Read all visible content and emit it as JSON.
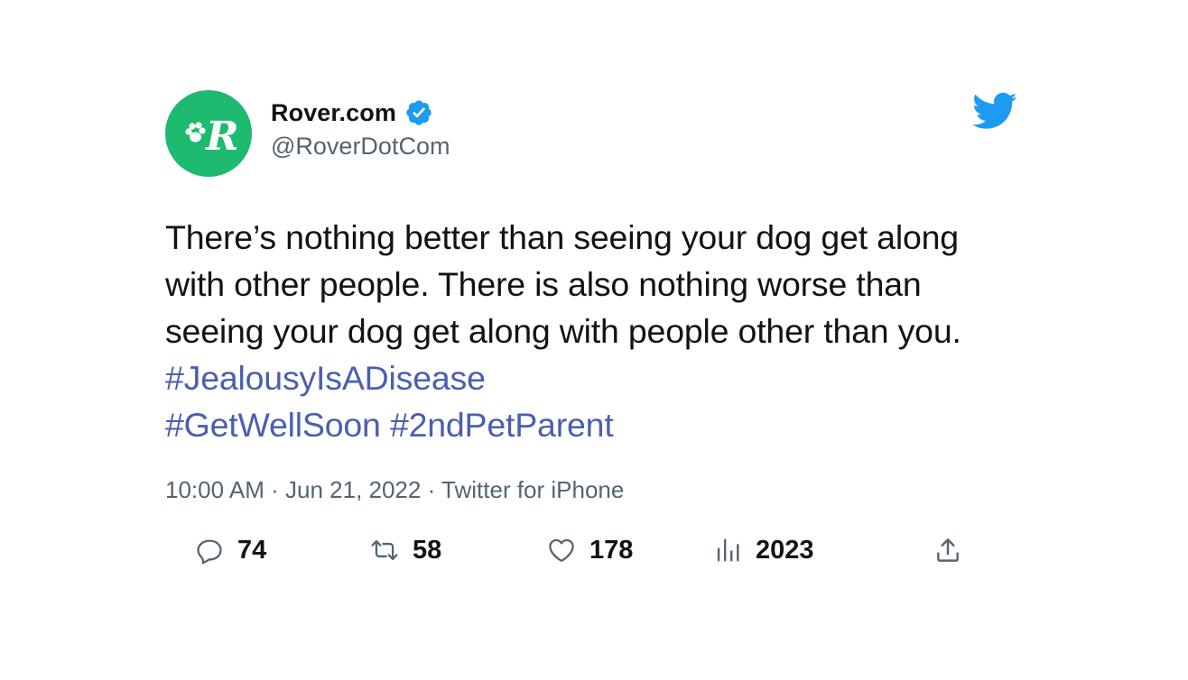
{
  "author": {
    "display_name": "Rover.com",
    "handle": "@RoverDotCom",
    "verified": true,
    "avatar_icon": "rover-logo-icon",
    "avatar_color": "#1dba6f"
  },
  "tweet": {
    "text": "There’s nothing better than seeing your dog get along with other people. There is also nothing worse than seeing your dog get along with people other than you.",
    "hashtags": [
      "#JealousyIsADisease",
      "#GetWellSoon",
      "#2ndPetParent"
    ],
    "hashtag_color": "#4a5fb0"
  },
  "meta": {
    "time": "10:00 AM",
    "separator": "·",
    "date": "Jun 21, 2022",
    "source": "Twitter for iPhone"
  },
  "actions": {
    "replies": "74",
    "retweets": "58",
    "likes": "178",
    "views": "2023"
  },
  "icons": {
    "brand": "twitter-bird-icon",
    "brand_color": "#1d9bf0",
    "verified": "verified-badge-icon",
    "reply": "reply-icon",
    "retweet": "retweet-icon",
    "like": "heart-icon",
    "views": "views-icon",
    "share": "share-icon"
  }
}
